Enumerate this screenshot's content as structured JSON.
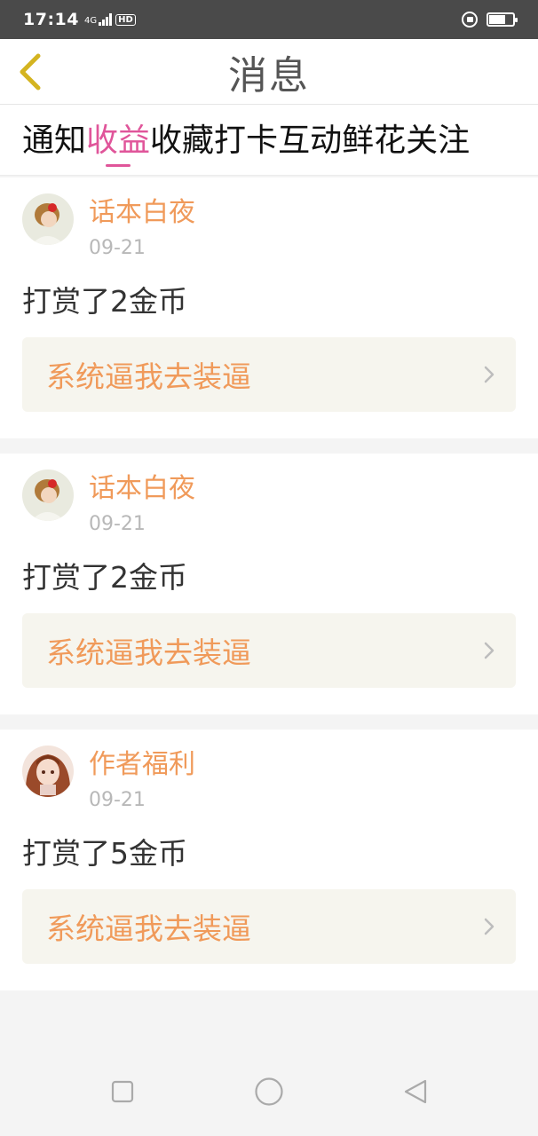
{
  "status_bar": {
    "time": "17:14",
    "network": "4G",
    "hd": "HD"
  },
  "header": {
    "title": "消息"
  },
  "tabs": [
    {
      "label": "通知",
      "active": false
    },
    {
      "label": "收益",
      "active": true
    },
    {
      "label": "收藏",
      "active": false
    },
    {
      "label": "打卡",
      "active": false
    },
    {
      "label": "互动",
      "active": false
    },
    {
      "label": "鲜花",
      "active": false
    },
    {
      "label": "关注",
      "active": false
    }
  ],
  "messages": [
    {
      "name": "话本白夜",
      "date": "09-21",
      "text": "打赏了2金币",
      "link": "系统逼我去装逼",
      "avatar": "girl-avatar-icon"
    },
    {
      "name": "话本白夜",
      "date": "09-21",
      "text": "打赏了2金币",
      "link": "系统逼我去装逼",
      "avatar": "girl-avatar-icon"
    },
    {
      "name": "作者福利",
      "date": "09-21",
      "text": "打赏了5金币",
      "link": "系统逼我去装逼",
      "avatar": "anime-girl-avatar-icon"
    }
  ],
  "colors": {
    "accent": "#e0559a",
    "orange": "#f09a5a",
    "back_arrow": "#d4b420"
  }
}
